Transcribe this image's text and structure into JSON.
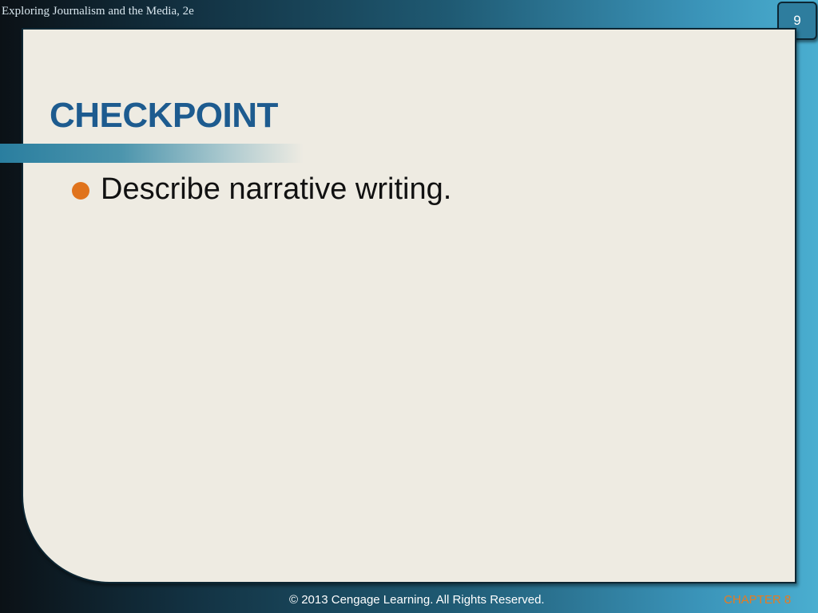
{
  "header": {
    "course_title": "Exploring  Journalism and the Media, 2e"
  },
  "slide": {
    "page_number": "9",
    "title": "CHECKPOINT",
    "bullets": [
      {
        "text": "Describe narrative writing."
      }
    ]
  },
  "footer": {
    "copyright": "© 2013 Cengage Learning. All Rights Reserved.",
    "chapter": "CHAPTER 8"
  },
  "colors": {
    "title": "#1d5b8f",
    "bullet": "#e0731c",
    "chapter_label": "#e87a1f",
    "panel_background": "#eeebe2",
    "frame_accent": "#4aaed0"
  }
}
